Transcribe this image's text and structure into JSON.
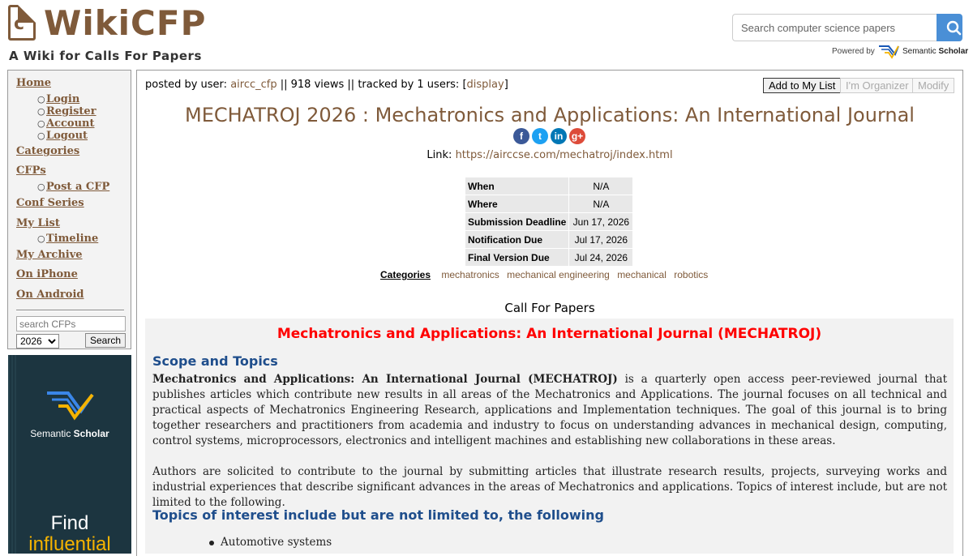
{
  "header": {
    "logo_letter": "c",
    "logo_text": "WikiCFP",
    "tagline": "A Wiki for Calls For Papers",
    "search_placeholder": "Search computer science papers",
    "powered_by": "Powered by",
    "semantic_scholar": "Semantic",
    "semantic_scholar_bold": "Scholar"
  },
  "sidebar": {
    "home": "Home",
    "login": "Login",
    "register": "Register",
    "account": "Account",
    "logout": "Logout",
    "categories": "Categories",
    "cfps": "CFPs",
    "post_cfp": "Post a CFP",
    "conf_series": "Conf Series",
    "my_list": "My List",
    "timeline": "Timeline",
    "my_archive": "My Archive",
    "on_iphone": "On iPhone",
    "on_android": "On Android",
    "search_placeholder": "search CFPs",
    "year": "2026",
    "search_button": "Search"
  },
  "ad": {
    "brand": "Semantic",
    "brand_bold": "Scholar",
    "find": "Find",
    "influential": "influential"
  },
  "post": {
    "posted_by_label": "posted by user:",
    "user": "aircc_cfp",
    "views": "|| 918 views || tracked by 1 users: [",
    "display": "display",
    "close_bracket": "]",
    "add_to_list": "Add to My List",
    "organizer": "I'm Organizer",
    "modify": "Modify"
  },
  "event": {
    "title": "MECHATROJ 2026 : Mechatronics and Applications: An International Journal",
    "link_label": "Link:",
    "link": "https://airccse.com/mechatroj/index.html",
    "share": {
      "facebook": "f",
      "twitter": "t",
      "linkedin": "in",
      "google": "g+"
    },
    "dates": [
      {
        "key": "When",
        "value": "N/A"
      },
      {
        "key": "Where",
        "value": "N/A"
      },
      {
        "key": "Submission Deadline",
        "value": "Jun 17, 2026"
      },
      {
        "key": "Notification Due",
        "value": "Jul 17, 2026"
      },
      {
        "key": "Final Version Due",
        "value": "Jul 24, 2026"
      }
    ],
    "categories_label": "Categories",
    "categories": [
      "mechatronics",
      "mechanical engineering",
      "mechanical",
      "robotics"
    ]
  },
  "cfp": {
    "heading": "Call For Papers",
    "title": "Mechatronics and Applications: An International Journal (MECHATROJ)",
    "scope_heading": "Scope and Topics",
    "para1_bold": "Mechatronics and Applications: An International Journal (MECHATROJ)",
    "para1": " is a quarterly open access peer-reviewed journal that publishes articles which contribute new results in all areas of the Mechatronics and Applications. The journal focuses on all technical and practical aspects of Mechatronics Engineering Research, applications and Implementation techniques. The goal of this journal is to bring together researchers and practitioners from academia and industry to focus on understanding advances in mechanical design, computing, control systems, microprocessors, electronics and intelligent machines and establishing new collaborations in these areas.",
    "para2": "Authors are solicited to contribute to the journal by submitting articles that illustrate research results, projects, surveying works and industrial experiences that describe significant advances in the areas of Mechatronics and applications. Topics of interest include, but are not limited to the following.",
    "topics_heading": "Topics of interest include but are not limited to, the following",
    "topics": [
      "Automotive systems"
    ]
  }
}
